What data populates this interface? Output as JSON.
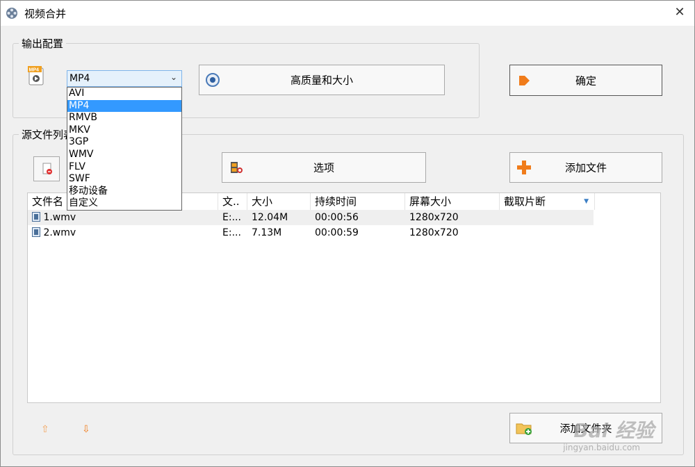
{
  "window": {
    "title": "视频合并",
    "close_glyph": "✕"
  },
  "output": {
    "group_label": "输出配置",
    "format_icon_label": "MP4",
    "format_selected": "MP4",
    "format_options": [
      "AVI",
      "MP4",
      "RMVB",
      "MKV",
      "3GP",
      "WMV",
      "FLV",
      "SWF",
      "移动设备",
      "自定义"
    ],
    "quality_button": "高质量和大小",
    "confirm_button": "确定"
  },
  "source": {
    "group_label": "源文件列表",
    "options_button": "选项",
    "add_file_button": "添加文件",
    "add_folder_button": "添加文件夹",
    "columns": [
      "文件名",
      "文..",
      "大小",
      "持续时间",
      "屏幕大小",
      "截取片断"
    ],
    "rows": [
      {
        "name": "1.wmv",
        "path": "E:...",
        "size": "12.04M",
        "duration": "00:00:56",
        "resolution": "1280x720",
        "clip": ""
      },
      {
        "name": "2.wmv",
        "path": "E:...",
        "size": "7.13M",
        "duration": "00:00:59",
        "resolution": "1280x720",
        "clip": ""
      }
    ]
  },
  "controls": {
    "move_up_glyph": "⇧",
    "move_down_glyph": "⇩"
  },
  "watermark": {
    "brand": "Bai 经验",
    "url": "jingyan.baidu.com"
  },
  "colors": {
    "selected_option": "#3399ff",
    "accent_orange": "#f07c1b"
  }
}
